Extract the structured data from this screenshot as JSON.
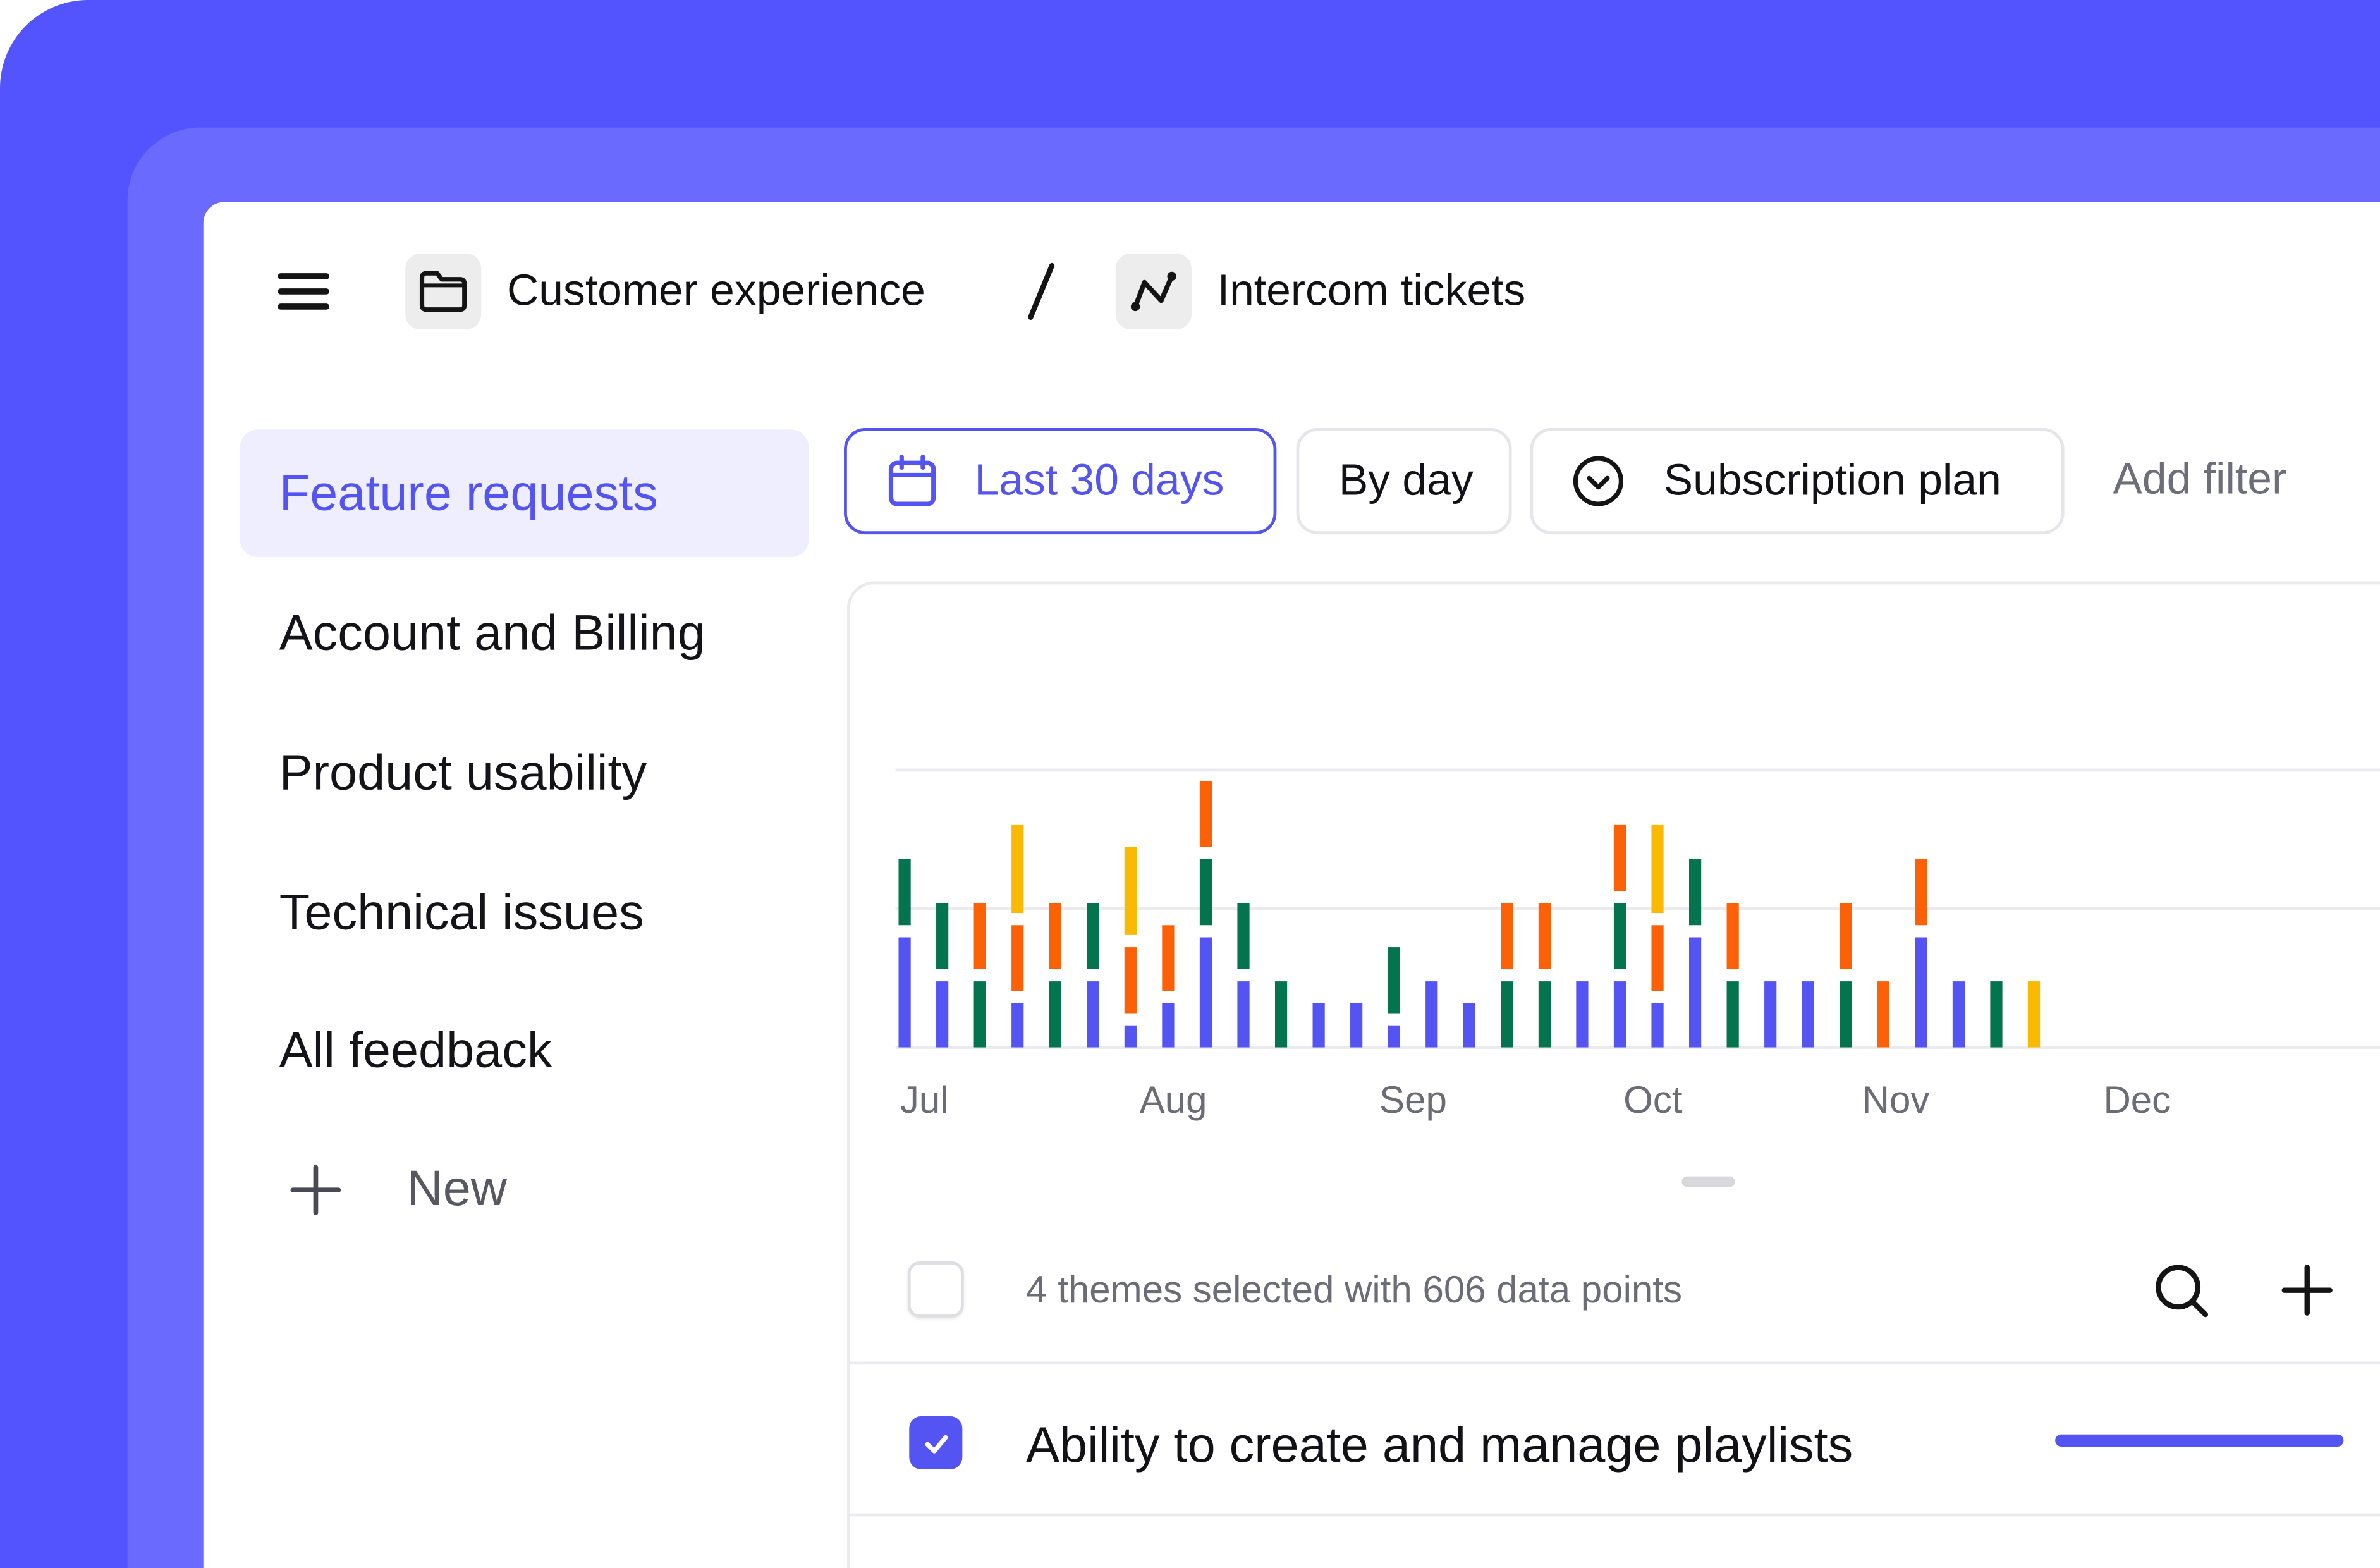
{
  "header": {
    "breadcrumb": [
      {
        "label": "Customer experience",
        "icon": "folder-icon"
      },
      {
        "label": "Intercom tickets",
        "icon": "chart-line-icon"
      }
    ],
    "separator": "/"
  },
  "sidebar": {
    "items": [
      {
        "label": "Feature requests",
        "active": true
      },
      {
        "label": "Account and Billing",
        "active": false
      },
      {
        "label": "Product usability",
        "active": false
      },
      {
        "label": "Technical issues",
        "active": false
      },
      {
        "label": "All feedback",
        "active": false
      }
    ],
    "new_label": "New"
  },
  "filters": {
    "date_range": "Last 30 days",
    "granularity": "By day",
    "segment": "Subscription plan",
    "add_filter": "Add filter"
  },
  "colors": {
    "accent": "#5454F2",
    "frame": "#5454FE",
    "series": [
      "#5454F2",
      "#04744F",
      "#FD6108",
      "#FABA04"
    ]
  },
  "chart_data": {
    "type": "bar",
    "stacked": true,
    "x_labels": [
      "Jul",
      "Aug",
      "Sep",
      "Oct",
      "Nov",
      "Dec"
    ],
    "grid": true,
    "ylim": [
      0,
      12
    ],
    "series_colors": [
      "#5454F2",
      "#04744F",
      "#FD6108",
      "#FABA04"
    ],
    "bars": [
      {
        "x": 0,
        "segments": [
          [
            0,
            5
          ],
          [
            1,
            3
          ]
        ]
      },
      {
        "x": 1,
        "segments": [
          [
            0,
            3
          ],
          [
            1,
            3
          ]
        ]
      },
      {
        "x": 2,
        "segments": [
          [
            1,
            3
          ],
          [
            2,
            3
          ]
        ]
      },
      {
        "x": 3,
        "segments": [
          [
            0,
            2
          ],
          [
            2,
            3
          ],
          [
            3,
            4
          ]
        ]
      },
      {
        "x": 4,
        "segments": [
          [
            1,
            3
          ],
          [
            2,
            3
          ]
        ]
      },
      {
        "x": 5,
        "segments": [
          [
            0,
            3
          ],
          [
            1,
            3
          ]
        ]
      },
      {
        "x": 6,
        "segments": [
          [
            0,
            1
          ],
          [
            2,
            3
          ],
          [
            3,
            4
          ]
        ]
      },
      {
        "x": 7,
        "segments": [
          [
            0,
            2
          ],
          [
            2,
            3
          ]
        ]
      },
      {
        "x": 8,
        "segments": [
          [
            0,
            5
          ],
          [
            1,
            3
          ],
          [
            2,
            3
          ]
        ]
      },
      {
        "x": 9,
        "segments": [
          [
            0,
            3
          ],
          [
            1,
            3
          ]
        ]
      },
      {
        "x": 10,
        "segments": [
          [
            1,
            3
          ]
        ]
      },
      {
        "x": 11,
        "segments": [
          [
            0,
            2
          ]
        ]
      },
      {
        "x": 12,
        "segments": [
          [
            0,
            2
          ]
        ]
      },
      {
        "x": 13,
        "segments": [
          [
            0,
            1
          ],
          [
            1,
            3
          ]
        ]
      },
      {
        "x": 14,
        "segments": [
          [
            0,
            3
          ]
        ]
      },
      {
        "x": 15,
        "segments": [
          [
            0,
            2
          ]
        ]
      },
      {
        "x": 16,
        "segments": [
          [
            1,
            3
          ],
          [
            2,
            3
          ]
        ]
      },
      {
        "x": 17,
        "segments": [
          [
            1,
            3
          ],
          [
            2,
            3
          ]
        ]
      },
      {
        "x": 18,
        "segments": [
          [
            0,
            3
          ]
        ]
      },
      {
        "x": 19,
        "segments": [
          [
            0,
            3
          ],
          [
            1,
            3
          ],
          [
            2,
            3
          ]
        ]
      },
      {
        "x": 20,
        "segments": [
          [
            0,
            2
          ],
          [
            2,
            3
          ],
          [
            3,
            4
          ]
        ]
      },
      {
        "x": 21,
        "segments": [
          [
            0,
            5
          ],
          [
            1,
            3
          ]
        ]
      },
      {
        "x": 22,
        "segments": [
          [
            1,
            3
          ],
          [
            2,
            3
          ]
        ]
      },
      {
        "x": 23,
        "segments": [
          [
            0,
            3
          ]
        ]
      },
      {
        "x": 24,
        "segments": [
          [
            0,
            3
          ]
        ]
      },
      {
        "x": 25,
        "segments": [
          [
            1,
            3
          ],
          [
            2,
            3
          ]
        ]
      },
      {
        "x": 26,
        "segments": [
          [
            2,
            3
          ]
        ]
      },
      {
        "x": 27,
        "segments": [
          [
            0,
            5
          ],
          [
            2,
            3
          ]
        ]
      },
      {
        "x": 28,
        "segments": [
          [
            0,
            3
          ]
        ]
      },
      {
        "x": 29,
        "segments": [
          [
            1,
            3
          ]
        ]
      },
      {
        "x": 30,
        "segments": [
          [
            3,
            3
          ]
        ]
      }
    ]
  },
  "selection": {
    "summary": "4 themes selected with 606 data points"
  },
  "themes": [
    {
      "label": "Ability to create and manage playlists",
      "checked": true,
      "share": 1.0
    }
  ]
}
